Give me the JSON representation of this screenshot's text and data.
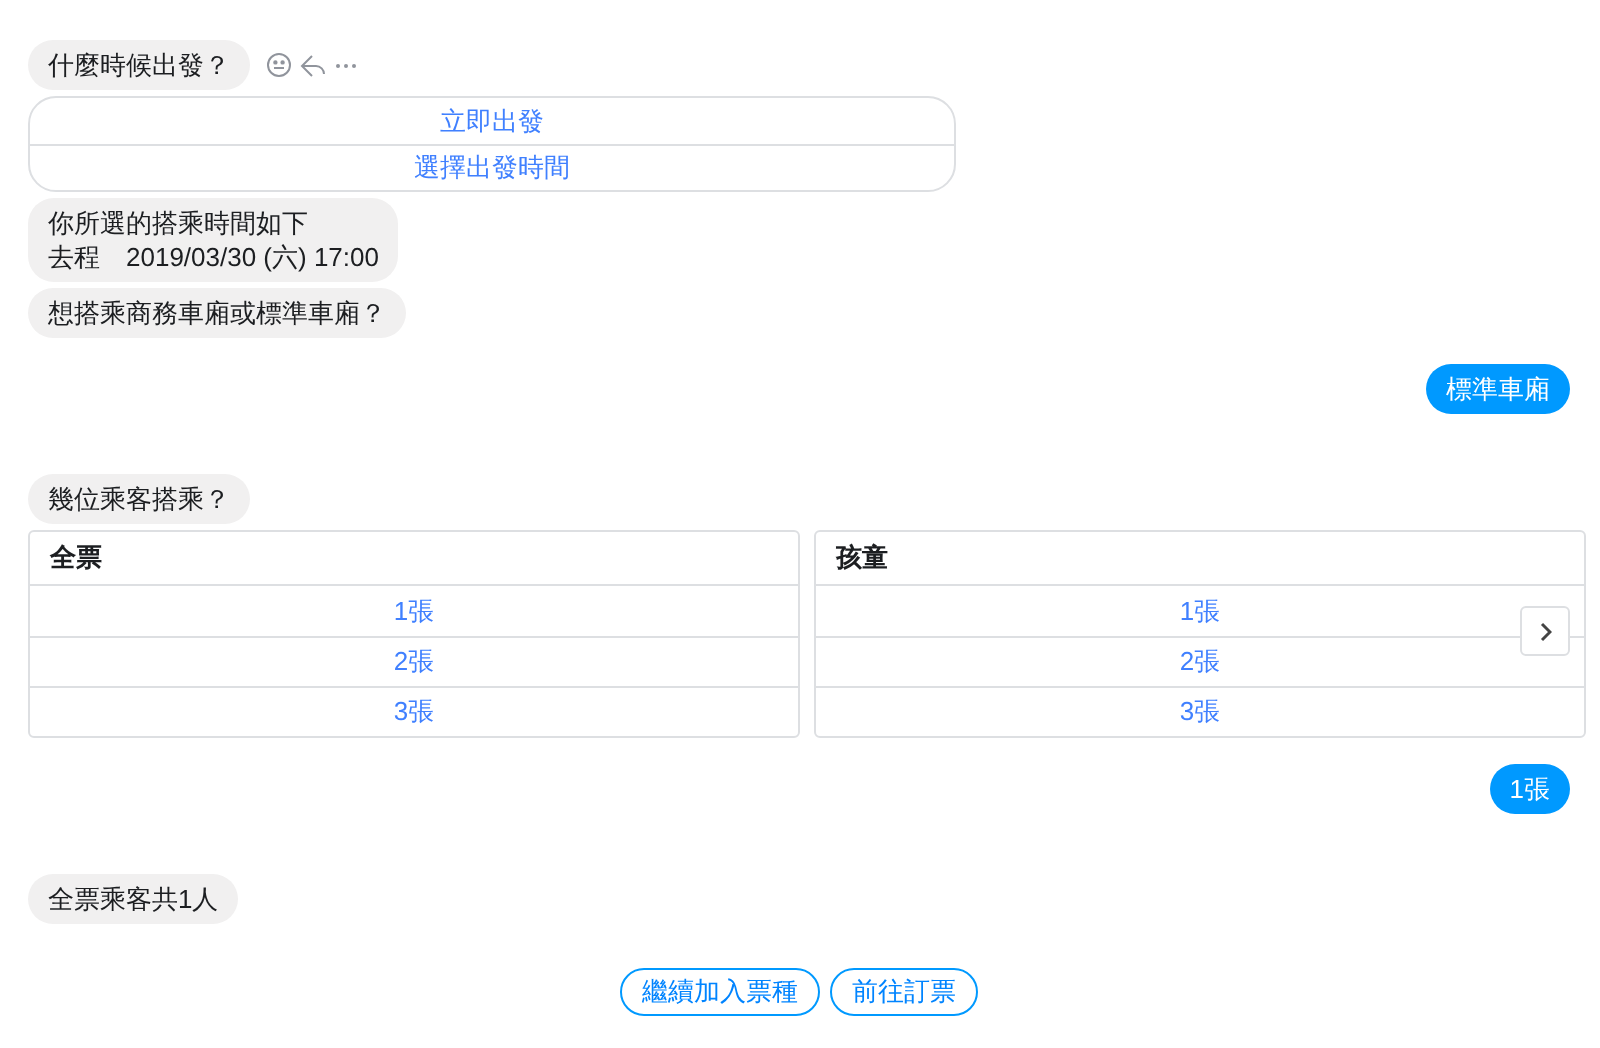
{
  "messages": [
    {
      "kind": "bubble",
      "outgoing": false,
      "lines": [
        "什麼時候出發？"
      ],
      "actions": true
    },
    {
      "kind": "buttons",
      "outgoing": false,
      "buttons": [
        "立即出發",
        "選擇出發時間"
      ]
    },
    {
      "kind": "bubble",
      "outgoing": false,
      "lines": [
        "你所選的搭乘時間如下",
        "去程　2019/03/30 (六) 17:00"
      ]
    },
    {
      "kind": "bubble",
      "outgoing": false,
      "lines": [
        "想搭乘商務車廂或標準車廂？"
      ]
    },
    {
      "kind": "bubble",
      "outgoing": true,
      "lines": [
        "標準車廂"
      ]
    },
    {
      "kind": "bubble",
      "outgoing": false,
      "lines": [
        "幾位乘客搭乘？"
      ]
    },
    {
      "kind": "carousel",
      "outgoing": false,
      "cards": [
        {
          "title": "全票",
          "buttons": [
            "1張",
            "2張",
            "3張"
          ]
        },
        {
          "title": "孩童",
          "buttons": [
            "1張",
            "2張",
            "3張"
          ]
        }
      ],
      "has_next": true
    },
    {
      "kind": "bubble",
      "outgoing": true,
      "lines": [
        "1張"
      ]
    },
    {
      "kind": "bubble",
      "outgoing": false,
      "lines": [
        "全票乘客共1人"
      ]
    },
    {
      "kind": "quick_replies",
      "outgoing": false,
      "buttons": [
        "繼續加入票種",
        "前往訂票"
      ]
    }
  ]
}
